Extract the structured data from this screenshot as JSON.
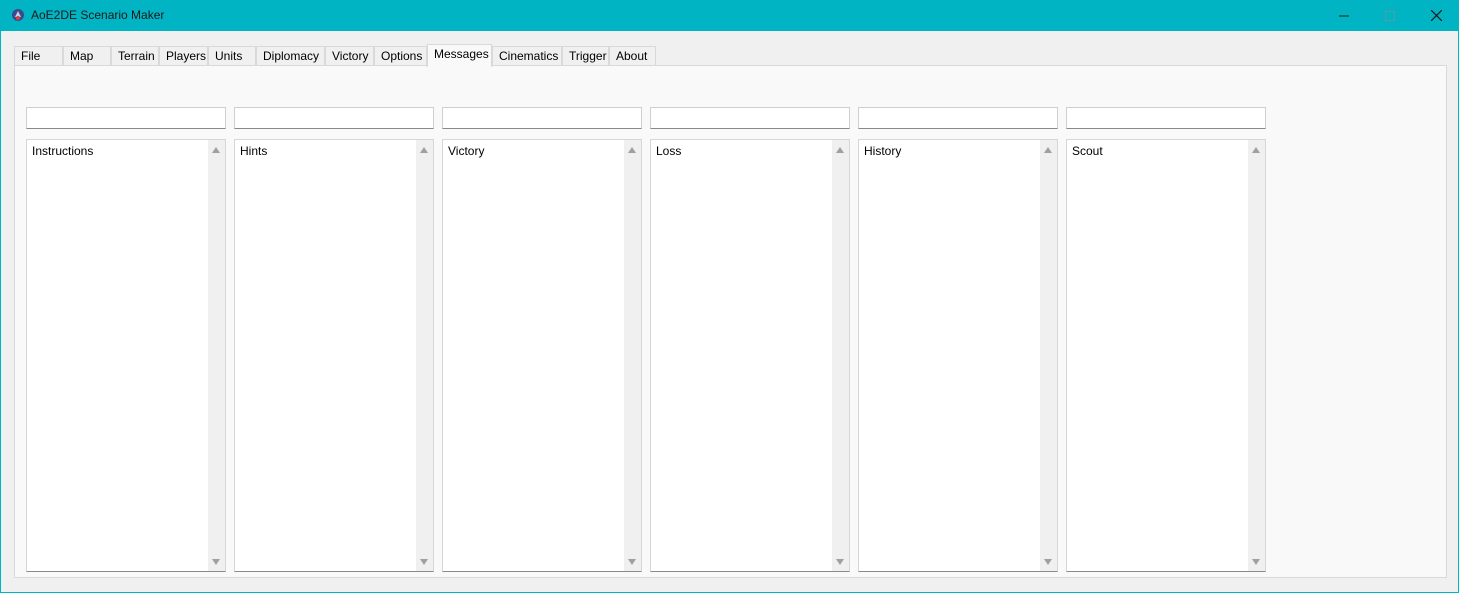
{
  "window": {
    "title": "AoE2DE Scenario Maker",
    "icon": "app-icon",
    "controls": [
      "minimize-icon",
      "maximize-icon",
      "close-icon"
    ]
  },
  "tabs": [
    {
      "label": "File"
    },
    {
      "label": "Map"
    },
    {
      "label": "Terrain"
    },
    {
      "label": "Players"
    },
    {
      "label": "Units"
    },
    {
      "label": "Diplomacy"
    },
    {
      "label": "Victory"
    },
    {
      "label": "Options"
    },
    {
      "label": "Messages",
      "active": true
    },
    {
      "label": "Cinematics"
    },
    {
      "label": "Trigger"
    },
    {
      "label": "About"
    }
  ],
  "messages": {
    "fields": [
      {
        "input_value": "",
        "text": "Instructions"
      },
      {
        "input_value": "",
        "text": "Hints"
      },
      {
        "input_value": "",
        "text": "Victory"
      },
      {
        "input_value": "",
        "text": "Loss"
      },
      {
        "input_value": "",
        "text": "History"
      },
      {
        "input_value": "",
        "text": "Scout"
      }
    ]
  },
  "colors": {
    "titlebar": "#00b4c4",
    "panel": "#f9f9f9",
    "client": "#f0f0f0"
  }
}
